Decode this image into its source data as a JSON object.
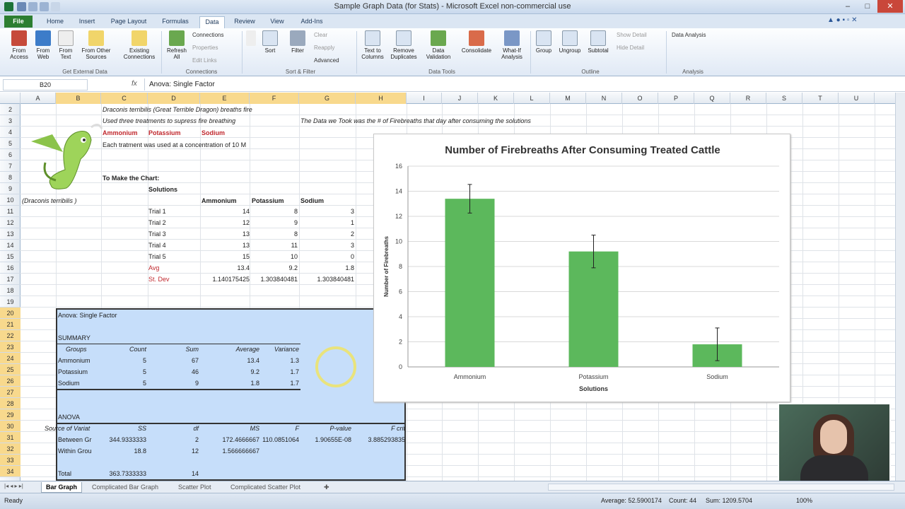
{
  "window": {
    "title": "Sample Graph Data (for Stats)  -  Microsoft Excel non-commercial use"
  },
  "tabs": [
    "File",
    "Home",
    "Insert",
    "Page Layout",
    "Formulas",
    "Data",
    "Review",
    "View",
    "Add-Ins"
  ],
  "ribbon": {
    "buttons": [
      "From Access",
      "From Web",
      "From Text",
      "From Other Sources",
      "Existing Connections",
      "Refresh All",
      "Sort",
      "Filter",
      "Text to Columns",
      "Remove Duplicates",
      "Data Validation",
      "Consolidate",
      "What-If Analysis",
      "Group",
      "Ungroup",
      "Subtotal"
    ],
    "small": {
      "connections": "Connections",
      "properties": "Properties",
      "edit_links": "Edit Links",
      "clear": "Clear",
      "reapply": "Reapply",
      "advanced": "Advanced",
      "show_detail": "Show Detail",
      "hide_detail": "Hide Detail",
      "data_analysis": "Data Analysis"
    },
    "groups": [
      "Get External Data",
      "Connections",
      "Sort & Filter",
      "Data Tools",
      "Outline",
      "Analysis"
    ]
  },
  "formula": {
    "namebox": "B20",
    "fx": "fx",
    "content": "Anova: Single Factor"
  },
  "columns": [
    "A",
    "B",
    "C",
    "D",
    "E",
    "F",
    "G",
    "H",
    "I",
    "J",
    "K",
    "L",
    "M",
    "N",
    "O",
    "P",
    "Q",
    "R",
    "S",
    "T",
    "U"
  ],
  "rows": [
    "2",
    "3",
    "4",
    "5",
    "6",
    "7",
    "8",
    "9",
    "10",
    "11",
    "12",
    "13",
    "14",
    "15",
    "16",
    "17",
    "18",
    "19",
    "20",
    "21",
    "22",
    "23",
    "24",
    "25",
    "26",
    "27",
    "28",
    "29",
    "30",
    "31",
    "32",
    "33",
    "34"
  ],
  "sheet": {
    "r2": "Draconis terribilis (Great Terrible Dragon) breaths fire",
    "r3a": "Used three treatments to supress fire breathing",
    "r3b": "The Data we Took was the # of Firebreaths that day after consuming the solutions",
    "r4": [
      "Ammonium",
      "Potassium",
      "Sodium"
    ],
    "r5": "Each tratment was used at a concentration of 10 M",
    "r8": "To Make the Chart:",
    "r9": "Solutions",
    "r10a": "(Draconis terribilis )",
    "r10": [
      "Ammonium",
      "Potassium",
      "Sodium"
    ],
    "trials": [
      {
        "label": "Trial 1",
        "vals": [
          "14",
          "8",
          "3"
        ]
      },
      {
        "label": "Trial 2",
        "vals": [
          "12",
          "9",
          "1"
        ]
      },
      {
        "label": "Trial 3",
        "vals": [
          "13",
          "8",
          "2"
        ]
      },
      {
        "label": "Trial 4",
        "vals": [
          "13",
          "11",
          "3"
        ]
      },
      {
        "label": "Trial 5",
        "vals": [
          "15",
          "10",
          "0"
        ]
      }
    ],
    "avg": {
      "label": "Avg",
      "vals": [
        "13.4",
        "9.2",
        "1.8"
      ]
    },
    "sd": {
      "label": "St. Dev",
      "vals": [
        "1.140175425",
        "1.303840481",
        "1.303840481"
      ]
    }
  },
  "anova": {
    "title": "Anova: Single Factor",
    "summary": "SUMMARY",
    "hdr": [
      "Groups",
      "Count",
      "Sum",
      "Average",
      "Variance"
    ],
    "rows": [
      [
        "Ammonium",
        "5",
        "67",
        "13.4",
        "1.3"
      ],
      [
        "Potassium",
        "5",
        "46",
        "9.2",
        "1.7"
      ],
      [
        "Sodium",
        "5",
        "9",
        "1.8",
        "1.7"
      ]
    ],
    "anova": "ANOVA",
    "hdr2": [
      "Source of Variat",
      "SS",
      "df",
      "MS",
      "F",
      "P-value",
      "F crit"
    ],
    "rows2": [
      [
        "Between Gr",
        "344.9333333",
        "2",
        "172.4666667",
        "110.0851064",
        "1.90655E-08",
        "3.885293835"
      ],
      [
        "Within Grou",
        "18.8",
        "12",
        "1.566666667",
        "",
        "",
        ""
      ],
      [
        "Total",
        "363.7333333",
        "14",
        "",
        "",
        "",
        ""
      ]
    ]
  },
  "chart_data": {
    "type": "bar",
    "title": "Number of Firebreaths After Consuming Treated Cattle",
    "categories": [
      "Ammonium",
      "Potassium",
      "Sodium"
    ],
    "values": [
      13.4,
      9.2,
      1.8
    ],
    "error": [
      1.140175425,
      1.303840481,
      1.303840481
    ],
    "xlabel": "Solutions",
    "ylabel": "Number of Firebreaths",
    "ylim": [
      0,
      16
    ],
    "yticks": [
      "0",
      "2",
      "4",
      "6",
      "8",
      "10",
      "12",
      "14",
      "16"
    ],
    "grid": true,
    "bar_color": "#5cb85c"
  },
  "sheettabs": [
    "Bar Graph",
    "Complicated Bar Graph",
    "Scatter Plot",
    "Complicated Scatter Plot"
  ],
  "status": {
    "ready": "Ready",
    "average": "Average: 52.5900174",
    "count": "Count: 44",
    "sum": "Sum: 1209.5704",
    "zoom": "100%"
  },
  "colors": {
    "excel_green": "#2d7e31",
    "selection": "#c6defa",
    "accent_red": "#c0272d"
  }
}
